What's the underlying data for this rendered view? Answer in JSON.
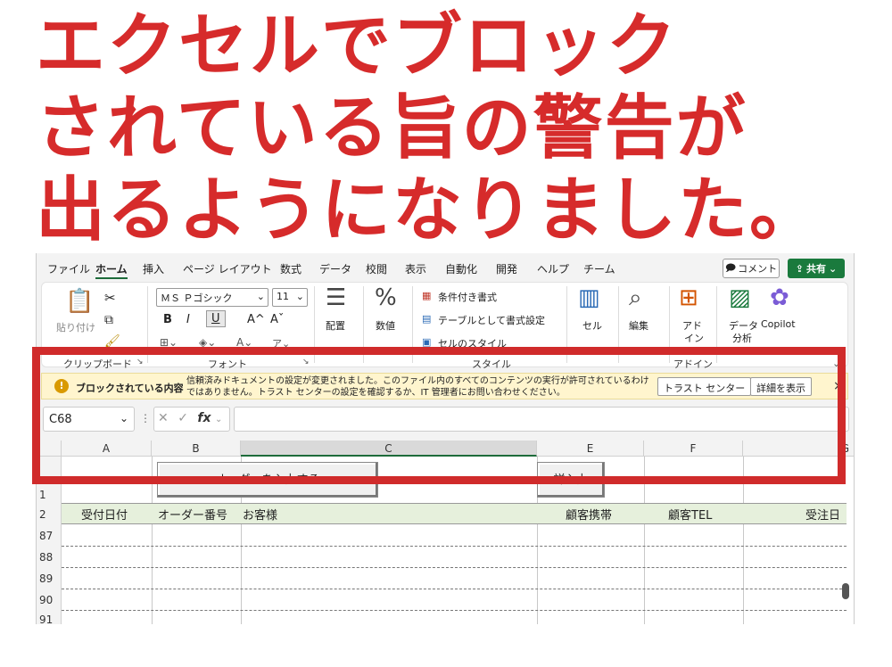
{
  "headline": {
    "line1": "エクセルでブロック",
    "line2": "されている旨の警告が",
    "line3": "出るようになりました。"
  },
  "menu": {
    "items": [
      "ファイル",
      "ホーム",
      "挿入",
      "ページ レイアウト",
      "数式",
      "データ",
      "校閲",
      "表示",
      "自動化",
      "開発",
      "ヘルプ",
      "チーム"
    ],
    "active": "ホーム",
    "comment": "コメント",
    "share": "共有"
  },
  "ribbon": {
    "paste": "貼り付け",
    "font_name": "ＭＳ Ｐゴシック",
    "font_size": "11",
    "bold": "B",
    "italic": "I",
    "underline": "U",
    "grow": "A^",
    "shrink": "Aˇ",
    "align": "配置",
    "number": "数値",
    "number_icon": "%",
    "cond_format": "条件付き書式",
    "table_format": "テーブルとして書式設定",
    "cell_style": "セルのスタイル",
    "cell": "セル",
    "edit": "編集",
    "addin": "アド\nイン",
    "addin_l1": "アド",
    "addin_l2": "イン",
    "data_analysis_l1": "データ",
    "data_analysis_l2": "分析",
    "copilot": "Copilot",
    "groups": {
      "clipboard": "クリップボード",
      "font": "フォント",
      "style": "スタイル",
      "addins": "アドイン"
    }
  },
  "message_bar": {
    "title": "ブロックされている内容",
    "text": "信頼済みドキュメントの設定が変更されました。このファイル内のすべてのコンテンツの実行が許可されているわけではありません。トラスト センターの設定を確認するか、IT 管理者にお問い合わせください。",
    "trust_center_button": "トラスト センター",
    "details_button": "詳細を表示",
    "close": "×"
  },
  "formula_bar": {
    "name_box": "C68",
    "fx": "fx",
    "value": ""
  },
  "sheet": {
    "columns": [
      "A",
      "B",
      "C",
      "E",
      "F",
      "G"
    ],
    "buttons": [
      "オーダーを入力する",
      "詳入力"
    ],
    "headers": [
      "受付日付",
      "オーダー番号",
      "お客様",
      "顧客携帯",
      "顧客TEL",
      "受注日"
    ],
    "row_numbers": [
      "1",
      "2",
      "87",
      "88",
      "89",
      "90",
      "91"
    ]
  },
  "colors": {
    "headline": "#d62b2b",
    "frame": "#d02b2b",
    "share": "#1a7a3d",
    "message_bar": "#fff5ce",
    "header_row": "#e6f0dc"
  }
}
